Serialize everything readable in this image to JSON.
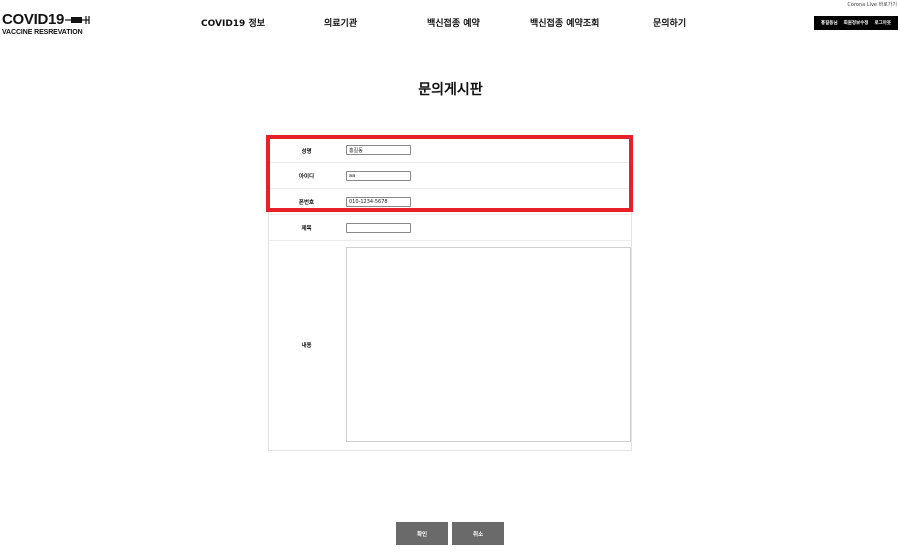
{
  "header": {
    "corona_link": "Corona Live 바로가기",
    "logo_title": "COVID19",
    "logo_subtitle": "VACCINE RESREVATION",
    "logo_icon": "syringe-icon"
  },
  "nav": {
    "items": [
      {
        "label": "COVID19 정보"
      },
      {
        "label": "의료기관"
      },
      {
        "label": "백신접종 예약"
      },
      {
        "label": "백신접종 예약조회"
      },
      {
        "label": "문의하기"
      }
    ]
  },
  "account": {
    "buttons": [
      {
        "label": "홍길동님"
      },
      {
        "label": "회원정보수정"
      },
      {
        "label": "로그아웃"
      }
    ]
  },
  "page": {
    "title": "문의게시판"
  },
  "form": {
    "name_label": "성명",
    "name_value": "홍길동",
    "id_label": "아이디",
    "id_value": "aa",
    "phone_label": "폰번호",
    "phone_value": "010-1234-5678",
    "subject_label": "제목",
    "subject_value": "",
    "content_label": "내용",
    "content_value": ""
  },
  "actions": {
    "confirm_label": "확인",
    "cancel_label": "취소"
  },
  "colors": {
    "highlight": "#e8202a",
    "button_bg": "#6a6a6a",
    "account_bar": "#000000"
  }
}
